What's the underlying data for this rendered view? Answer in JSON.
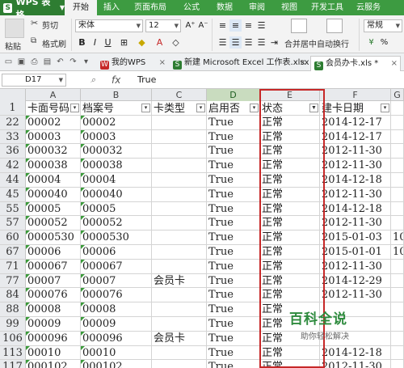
{
  "app": {
    "name": "WPS 表格"
  },
  "menu_tabs": [
    "开始",
    "插入",
    "页面布局",
    "公式",
    "数据",
    "审阅",
    "视图",
    "开发工具",
    "云服务"
  ],
  "ribbon": {
    "paste": "粘贴",
    "cut": "剪切",
    "copy": "复制",
    "format_painter": "格式刷",
    "font_name": "宋体",
    "font_size": "12",
    "merge_center": "合并居中",
    "wrap_text": "自动换行",
    "number_format": "常规"
  },
  "doc_tabs": [
    {
      "label": "我的WPS",
      "active": false
    },
    {
      "label": "新建 Microsoft Excel 工作表.xlsx *",
      "active": false
    },
    {
      "label": "会员办卡.xls *",
      "active": true
    }
  ],
  "formula_bar": {
    "cell_ref": "D17",
    "fx": "fx",
    "value": "True"
  },
  "columns": [
    "A",
    "B",
    "C",
    "D",
    "E",
    "F",
    "G"
  ],
  "header_row": {
    "num": "1",
    "cells": [
      "卡面号码",
      "档案号",
      "卡类型",
      "启用否",
      "状态",
      "建卡日期",
      ""
    ]
  },
  "rows": [
    {
      "num": "22",
      "cells": [
        "00002",
        "00002",
        "",
        "True",
        "正常",
        "2014-12-17",
        ""
      ]
    },
    {
      "num": "33",
      "cells": [
        "00003",
        "00003",
        "",
        "True",
        "正常",
        "2014-12-17",
        ""
      ]
    },
    {
      "num": "36",
      "cells": [
        "000032",
        "000032",
        "",
        "True",
        "正常",
        "2012-11-30",
        ""
      ]
    },
    {
      "num": "42",
      "cells": [
        "000038",
        "000038",
        "",
        "True",
        "正常",
        "2012-11-30",
        ""
      ]
    },
    {
      "num": "44",
      "cells": [
        "00004",
        "00004",
        "",
        "True",
        "正常",
        "2014-12-18",
        ""
      ]
    },
    {
      "num": "45",
      "cells": [
        "000040",
        "000040",
        "",
        "True",
        "正常",
        "2012-11-30",
        ""
      ]
    },
    {
      "num": "55",
      "cells": [
        "00005",
        "00005",
        "",
        "True",
        "正常",
        "2014-12-18",
        ""
      ]
    },
    {
      "num": "57",
      "cells": [
        "000052",
        "000052",
        "",
        "True",
        "正常",
        "2012-11-30",
        ""
      ]
    },
    {
      "num": "60",
      "cells": [
        "0000530",
        "0000530",
        "",
        "True",
        "正常",
        "2015-01-03",
        "10"
      ]
    },
    {
      "num": "67",
      "cells": [
        "00006",
        "00006",
        "",
        "True",
        "正常",
        "2015-01-01",
        "10"
      ]
    },
    {
      "num": "71",
      "cells": [
        "000067",
        "000067",
        "",
        "True",
        "正常",
        "2012-11-30",
        ""
      ]
    },
    {
      "num": "77",
      "cells": [
        "00007",
        "00007",
        "会员卡",
        "True",
        "正常",
        "2014-12-29",
        ""
      ]
    },
    {
      "num": "84",
      "cells": [
        "000076",
        "000076",
        "",
        "True",
        "正常",
        "2012-11-30",
        ""
      ]
    },
    {
      "num": "88",
      "cells": [
        "00008",
        "00008",
        "",
        "True",
        "正常",
        "",
        ""
      ]
    },
    {
      "num": "99",
      "cells": [
        "00009",
        "00009",
        "",
        "True",
        "正常",
        "",
        ""
      ]
    },
    {
      "num": "106",
      "cells": [
        "000096",
        "000096",
        "会员卡",
        "True",
        "正常",
        "",
        ""
      ]
    },
    {
      "num": "113",
      "cells": [
        "00010",
        "00010",
        "",
        "True",
        "正常",
        "2014-12-18",
        ""
      ]
    },
    {
      "num": "117",
      "cells": [
        "000102",
        "000102",
        "",
        "True",
        "正常",
        "2012-11-30",
        ""
      ]
    }
  ],
  "watermark": {
    "logo": "百科全说",
    "sub": "助你轻松解决"
  }
}
